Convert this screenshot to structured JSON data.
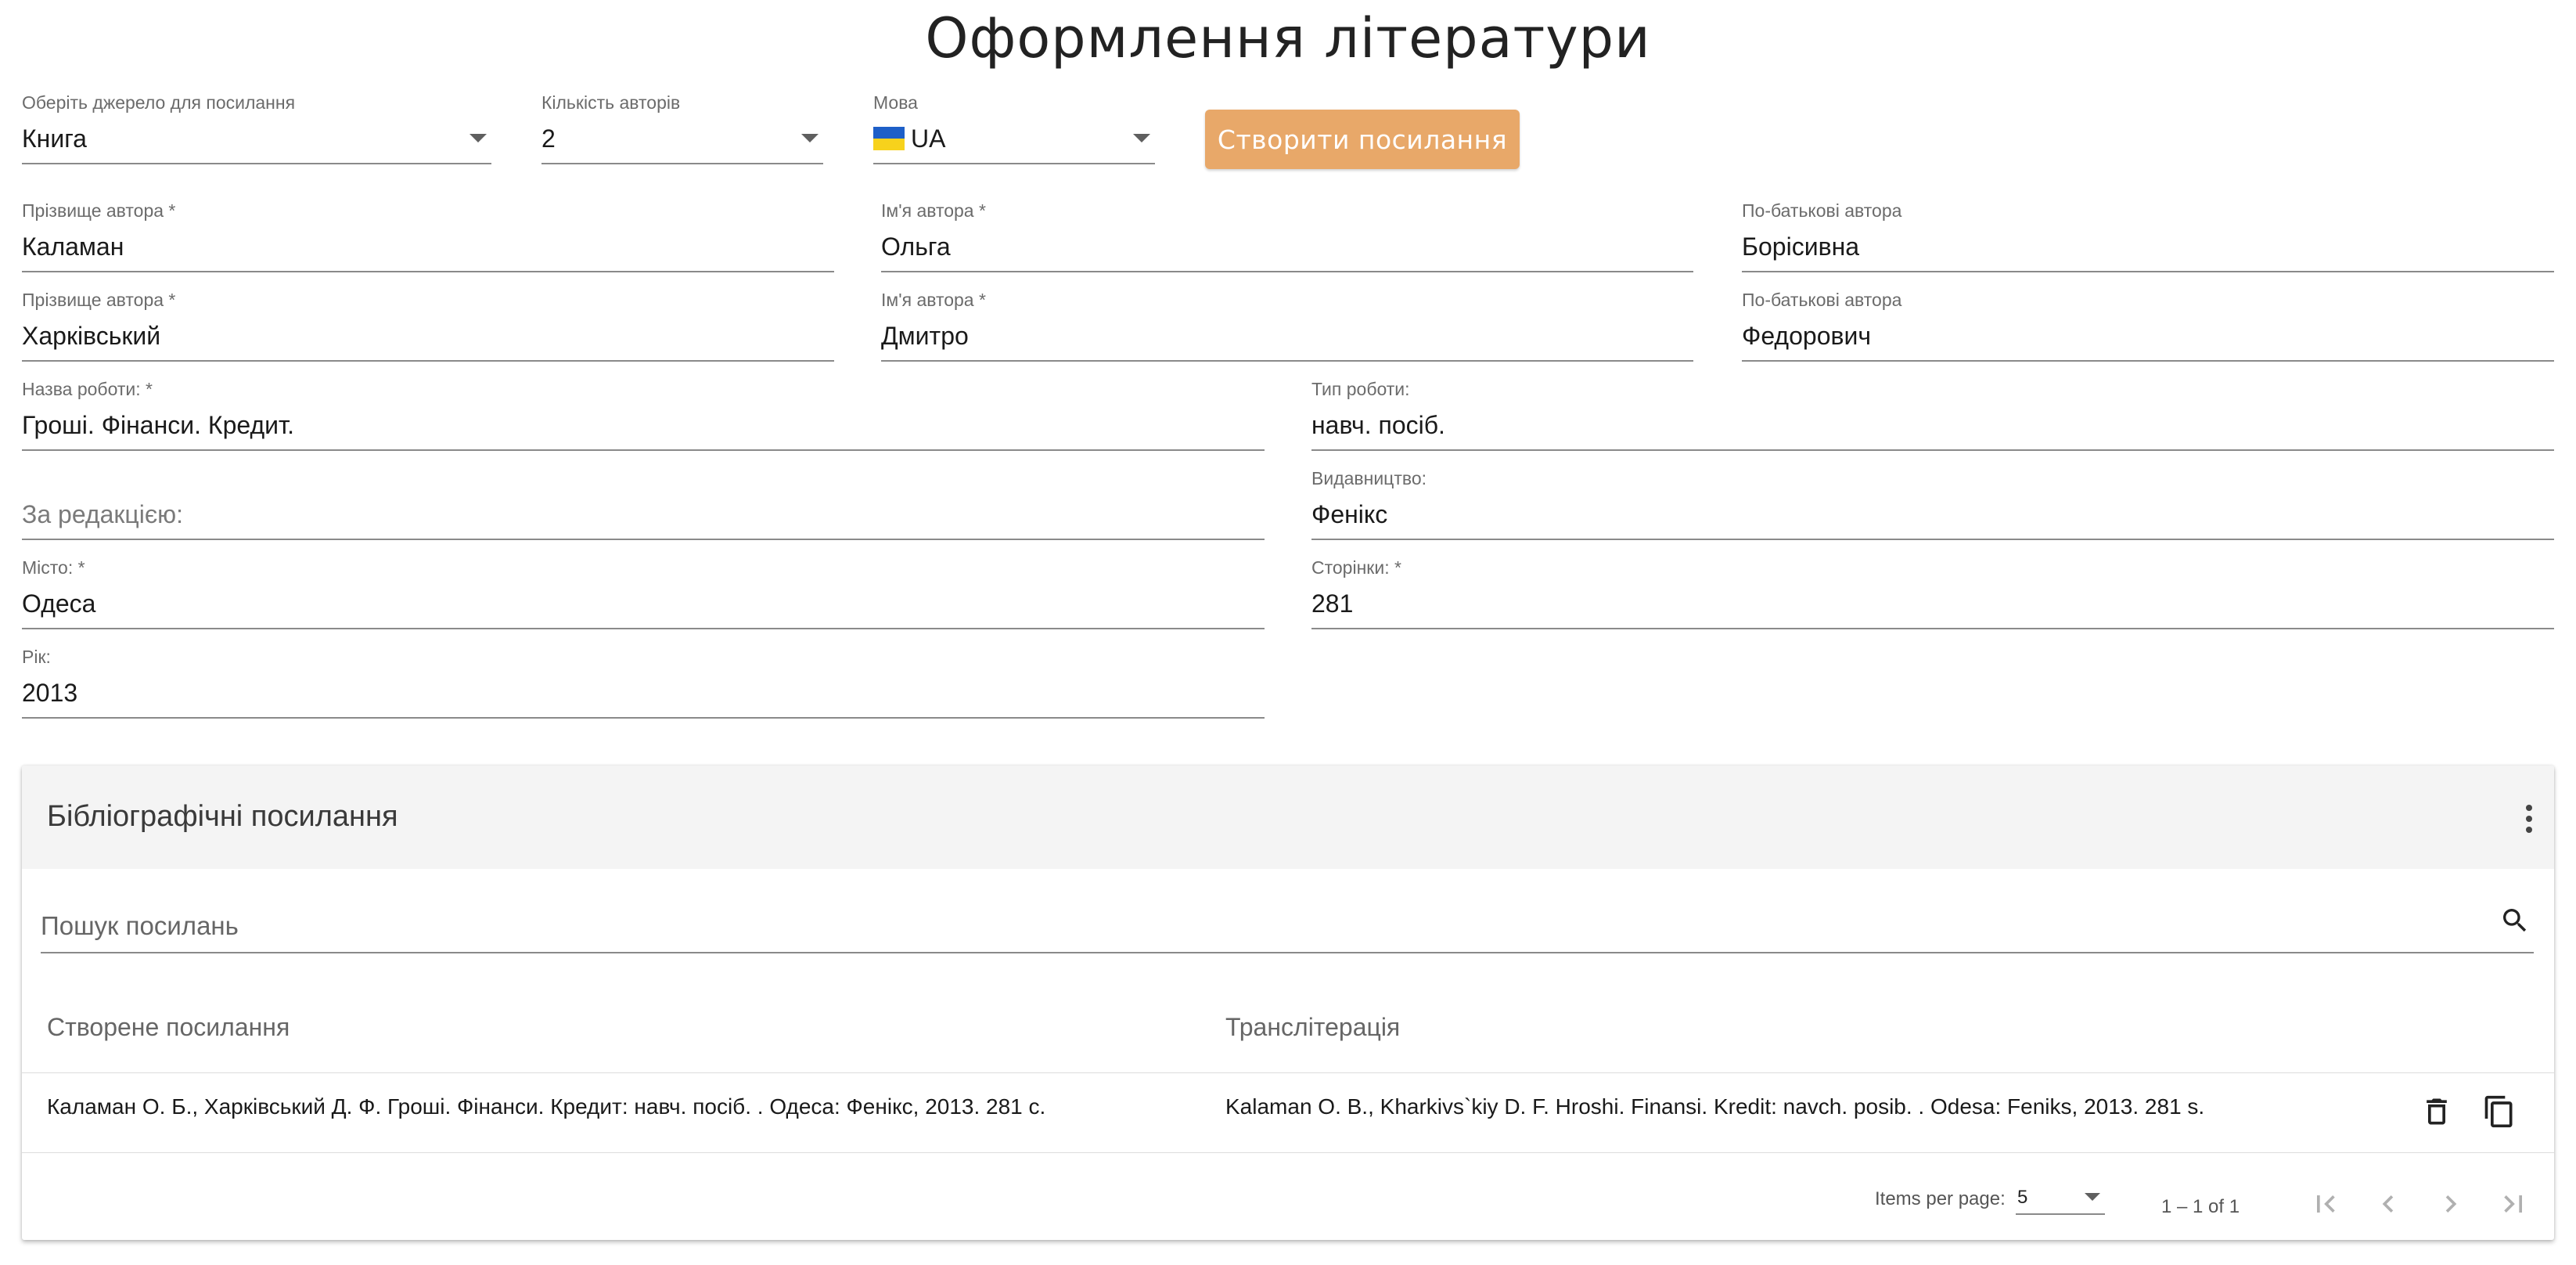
{
  "page": {
    "title": "Оформлення літератури"
  },
  "controls": {
    "source": {
      "label": "Оберіть джерело для посилання",
      "value": "Книга"
    },
    "author_count": {
      "label": "Кількість авторів",
      "value": "2"
    },
    "language": {
      "label": "Мова",
      "value": "UA"
    },
    "create_button": "Створити посилання"
  },
  "authors": [
    {
      "surname_label": "Прізвище автора *",
      "surname": "Каламан",
      "name_label": "Ім'я автора *",
      "name": "Ольга",
      "patronymic_label": "По-батькові автора",
      "patronymic": "Борісивна"
    },
    {
      "surname_label": "Прізвище автора *",
      "surname": "Харківський",
      "name_label": "Ім'я автора *",
      "name": "Дмитро",
      "patronymic_label": "По-батькові автора",
      "patronymic": "Федорович"
    }
  ],
  "work": {
    "title_label": "Назва роботи: *",
    "title": "Гроші. Фінанси. Кредит.",
    "type_label": "Тип роботи:",
    "type": "навч. посіб.",
    "editor_placeholder": "За редакцією:",
    "publisher_label": "Видавництво:",
    "publisher": "Фенікс",
    "city_label": "Місто: *",
    "city": "Одеса",
    "pages_label": "Сторінки: *",
    "pages": "281",
    "year_label": "Рік:",
    "year": "2013"
  },
  "references": {
    "title": "Бібліографічні посилання",
    "search_placeholder": "Пошук посилань",
    "columns": [
      "Створене посилання",
      "Транслітерація"
    ],
    "rows": [
      {
        "created": "Каламан О. Б., Харківський Д. Ф. Гроші. Фінанси. Кредит: навч. посіб. . Одеса: Фенікс, 2013. 281 с.",
        "transliteration": "Kalaman O. B., Kharkivs`kiy D. F. Hroshi. Finansi. Kredit: navch. posib. . Odesa: Feniks, 2013. 281 s."
      }
    ],
    "paginator": {
      "items_per_page_label": "Items per page:",
      "items_per_page": "5",
      "range": "1 – 1 of 1"
    }
  },
  "colors": {
    "accent": "#e8a869",
    "header_bg": "#f4f4f4"
  }
}
